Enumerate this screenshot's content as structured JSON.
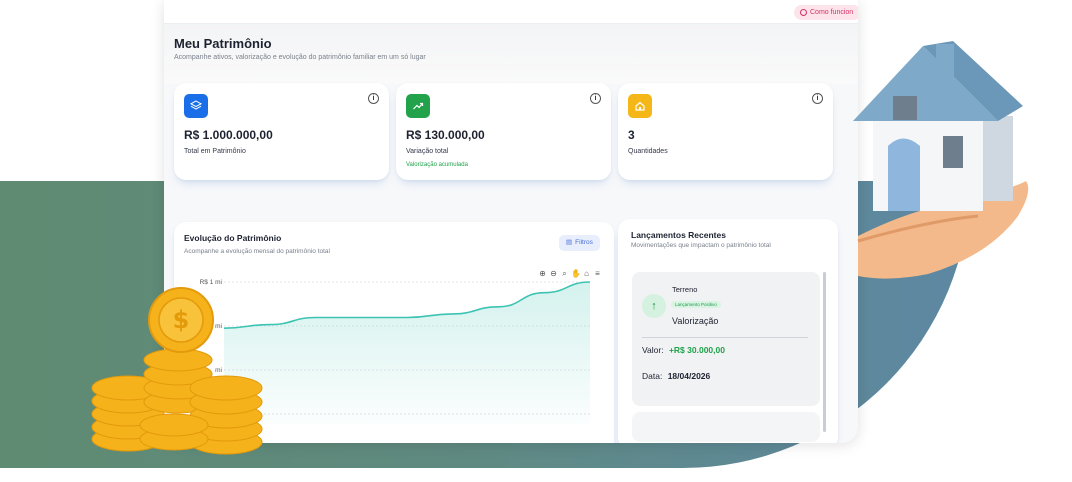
{
  "topbar": {
    "help_label": "Como funcion"
  },
  "header": {
    "title": "Meu Patrimônio",
    "subtitle": "Acompanhe ativos, valorização e evolução do patrimônio familiar em um só lugar"
  },
  "stats": [
    {
      "icon": "layers-icon",
      "icon_color": "#1a6fe8",
      "value": "R$ 1.000.000,00",
      "label": "Total em Patrimônio",
      "hint": ""
    },
    {
      "icon": "trending-up-icon",
      "icon_color": "#22a24b",
      "value": "R$ 130.000,00",
      "label": "Variação total",
      "hint": "Valorização acumulada"
    },
    {
      "icon": "home-icon",
      "icon_color": "#f5b718",
      "value": "3",
      "label": "Quantidades",
      "hint": ""
    }
  ],
  "evolution": {
    "title": "Evolução do Patrimônio",
    "subtitle": "Acompanhe a evolução mensal do patrimônio total",
    "filter_label": "Filtros"
  },
  "chart_data": {
    "type": "area",
    "title": "Evolução do Patrimônio",
    "y_tick_labels": [
      "R$ 1 mi",
      "mi",
      "mi"
    ],
    "series": [
      {
        "values": [
          0.87,
          0.88,
          0.9,
          0.9,
          0.9,
          0.91,
          0.93,
          0.97,
          1.0
        ]
      }
    ],
    "ylim": [
      0.6,
      1.0
    ],
    "grid": true,
    "color": "#3cc3b2"
  },
  "recent": {
    "title": "Lançamentos Recentes",
    "subtitle": "Movimentações que impactam o patrimônio total",
    "entries": [
      {
        "name": "Terreno",
        "tag": "Lançamento Positivo",
        "kind": "Valorização",
        "value_label": "Valor:",
        "value": "+R$ 30.000,00",
        "date_label": "Data:",
        "date": "18/04/2026"
      }
    ]
  },
  "colors": {
    "accent": "#1a6fe8",
    "positive": "#1ea24a",
    "background_blob": "#5f8a80"
  }
}
